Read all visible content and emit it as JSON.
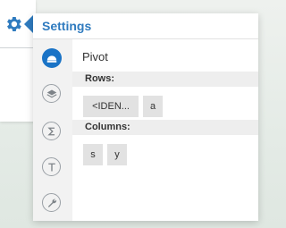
{
  "panel": {
    "title": "Settings",
    "content_title": "Pivot"
  },
  "sidebar": {
    "items": [
      {
        "name": "pivot-icon",
        "active": true
      },
      {
        "name": "layers-icon",
        "active": false
      },
      {
        "name": "sigma-icon",
        "active": false
      },
      {
        "name": "text-icon",
        "active": false
      },
      {
        "name": "wrench-icon",
        "active": false
      }
    ]
  },
  "rows": {
    "label": "Rows:",
    "chips": [
      "<IDEN...",
      "a"
    ]
  },
  "columns": {
    "label": "Columns:",
    "chips": [
      "s",
      "y"
    ]
  },
  "colors": {
    "accent": "#2f7bbf",
    "active_icon": "#1a73c6",
    "chip_bg": "#e2e2e2",
    "section_bg": "#eeeeee",
    "sidebar_bg": "#f2f2f2"
  }
}
